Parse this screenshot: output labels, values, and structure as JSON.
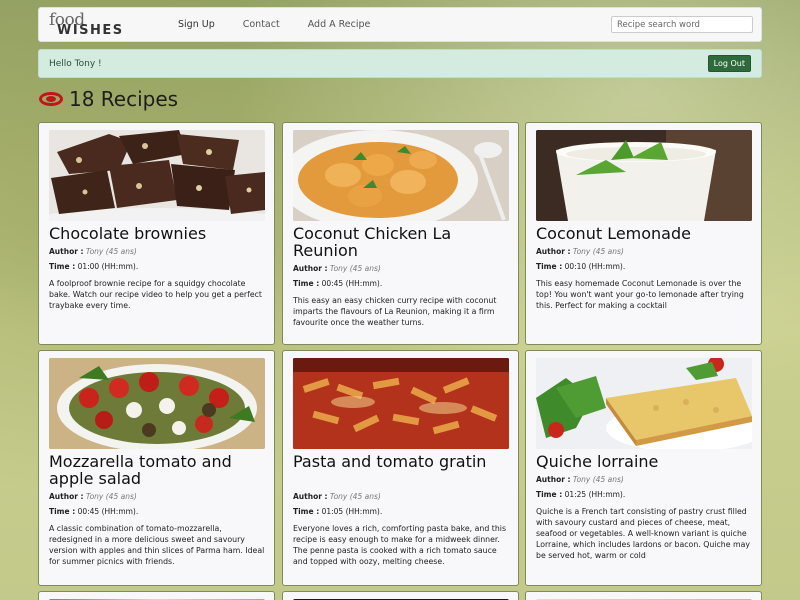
{
  "nav": {
    "logo_top": "food",
    "logo_bottom": "WISHES",
    "links": [
      "Sign Up",
      "Contact",
      "Add A Recipe"
    ],
    "search_placeholder": "Recipe search word"
  },
  "alert": {
    "message": "Hello Tony !",
    "logout_label": "Log Out"
  },
  "heading": {
    "text": "18 Recipes"
  },
  "labels": {
    "author": "Author :",
    "time": "Time :"
  },
  "recipes": [
    {
      "title": "Chocolate brownies",
      "author": "Tony (45 ans)",
      "time": "01:00 (HH:mm).",
      "description": "A foolproof brownie recipe for a squidgy chocolate bake. Watch our recipe video to help you get a perfect traybake every time."
    },
    {
      "title": "Coconut Chicken La Reunion",
      "author": "Tony (45 ans)",
      "time": "00:45 (HH:mm).",
      "description": "This easy an easy chicken curry recipe with coconut imparts the flavours of La Reunion, making it a firm favourite once the weather turns."
    },
    {
      "title": "Coconut Lemonade",
      "author": "Tony (45 ans)",
      "time": "00:10 (HH:mm).",
      "description": "This easy homemade Coconut Lemonade is over the top! You won't want your go-to lemonade after trying this. Perfect for making a cocktail"
    },
    {
      "title": "Mozzarella tomato and apple salad",
      "author": "Tony (45 ans)",
      "time": "00:45 (HH:mm).",
      "description": "A classic combination of tomato-mozzarella, redesigned in a more delicious sweet and savoury version with apples and thin slices of Parma ham. Ideal for summer picnics with friends."
    },
    {
      "title": "Pasta and tomato gratin",
      "author": "Tony (45 ans)",
      "time": "01:05 (HH:mm).",
      "description": "Everyone loves a rich, comforting pasta bake, and this recipe is easy enough to make for a midweek dinner. The penne pasta is cooked with a rich tomato sauce and topped with oozy, melting cheese."
    },
    {
      "title": "Quiche lorraine",
      "author": "Tony (45 ans)",
      "time": "01:25 (HH:mm).",
      "description": "Quiche is a French tart consisting of pastry crust filled with savoury custard and pieces of cheese, meat, seafood or vegetables. A well-known variant is quiche Lorraine, which includes lardons or bacon. Quiche may be served hot, warm or cold"
    }
  ]
}
